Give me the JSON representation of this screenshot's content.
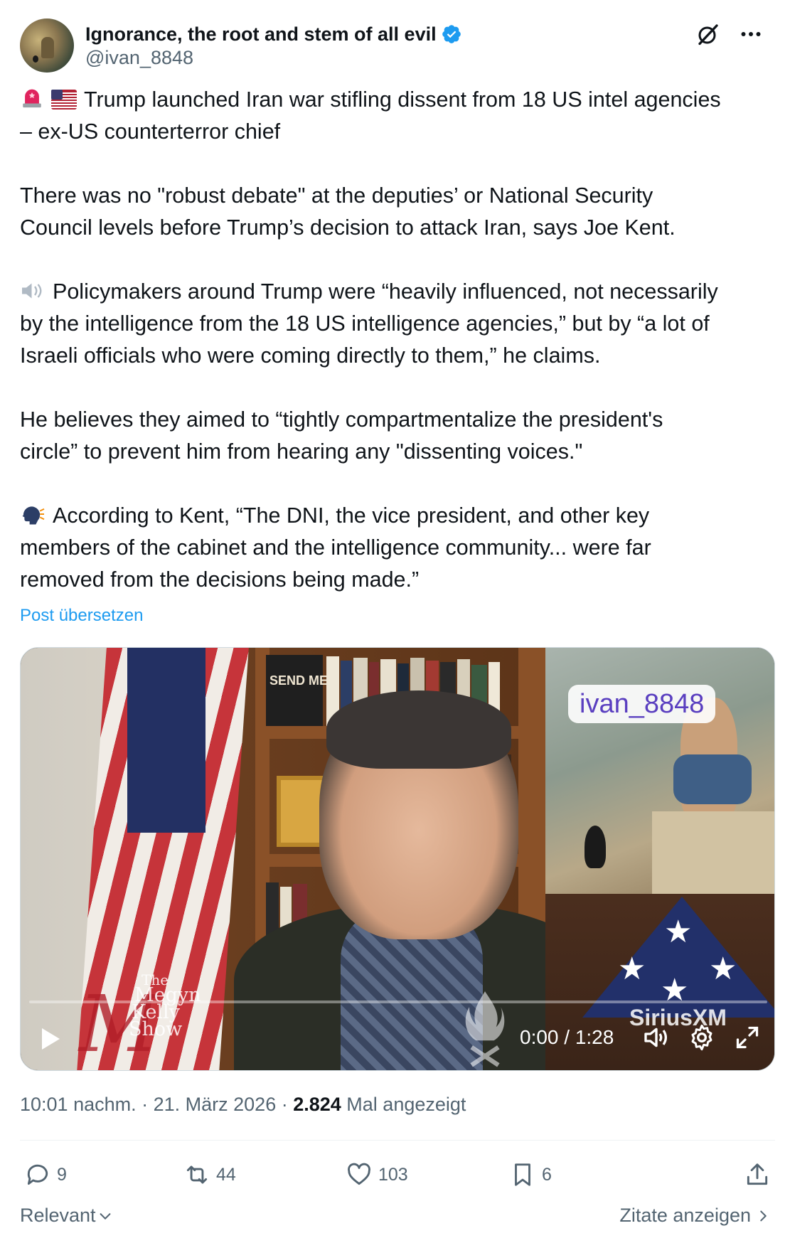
{
  "author": {
    "display_name": "Ignorance, the root and stem of all evil",
    "handle": "@ivan_8848"
  },
  "icons": {
    "verified": "verified-badge-icon",
    "grok": "grok-icon",
    "more": "more-icon"
  },
  "post": {
    "lines": [
      "Trump launched Iran war stifling dissent from 18 US intel agencies",
      "– ex-US counterterror chief",
      "There was no \"robust debate\" at the deputies’ or National Security",
      "Council levels before Trump’s decision to attack Iran, says Joe Kent.",
      "Policymakers around Trump were “heavily influenced, not necessarily",
      "by the intelligence from the 18 US intelligence agencies,” but by “a lot of",
      "Israeli officials who were coming directly to them,” he claims.",
      "He believes they aimed to “tightly compartmentalize the president's",
      "circle” to prevent him from hearing any \"dissenting voices.\"",
      "According to Kent, “The DNI, the vice president, and other key",
      "members of the cabinet and the intelligence community... were far",
      "removed from the decisions being made.”"
    ],
    "translate_label": "Post übersetzen"
  },
  "video": {
    "watermark": "ivan_8848",
    "logo_the": "The",
    "logo_line1": "Megyn",
    "logo_line2": "Kelly",
    "logo_line3": "Show",
    "brand": "SiriusXM",
    "book_title": "SEND ME",
    "time": "0:00 / 1:28",
    "progress": 0
  },
  "meta": {
    "time": "10:01 nachm.",
    "sep1": " · ",
    "date": "21. März 2026",
    "sep2": " · ",
    "views": "2.824",
    "views_label": " Mal angezeigt"
  },
  "actions": {
    "replies": "9",
    "reposts": "44",
    "likes": "103",
    "bookmarks": "6"
  },
  "footer": {
    "sort_label": "Relevant",
    "quotes_label": "Zitate anzeigen"
  },
  "colors": {
    "accent": "#1d9bf0",
    "text": "#0f1419",
    "muted": "#536471"
  }
}
